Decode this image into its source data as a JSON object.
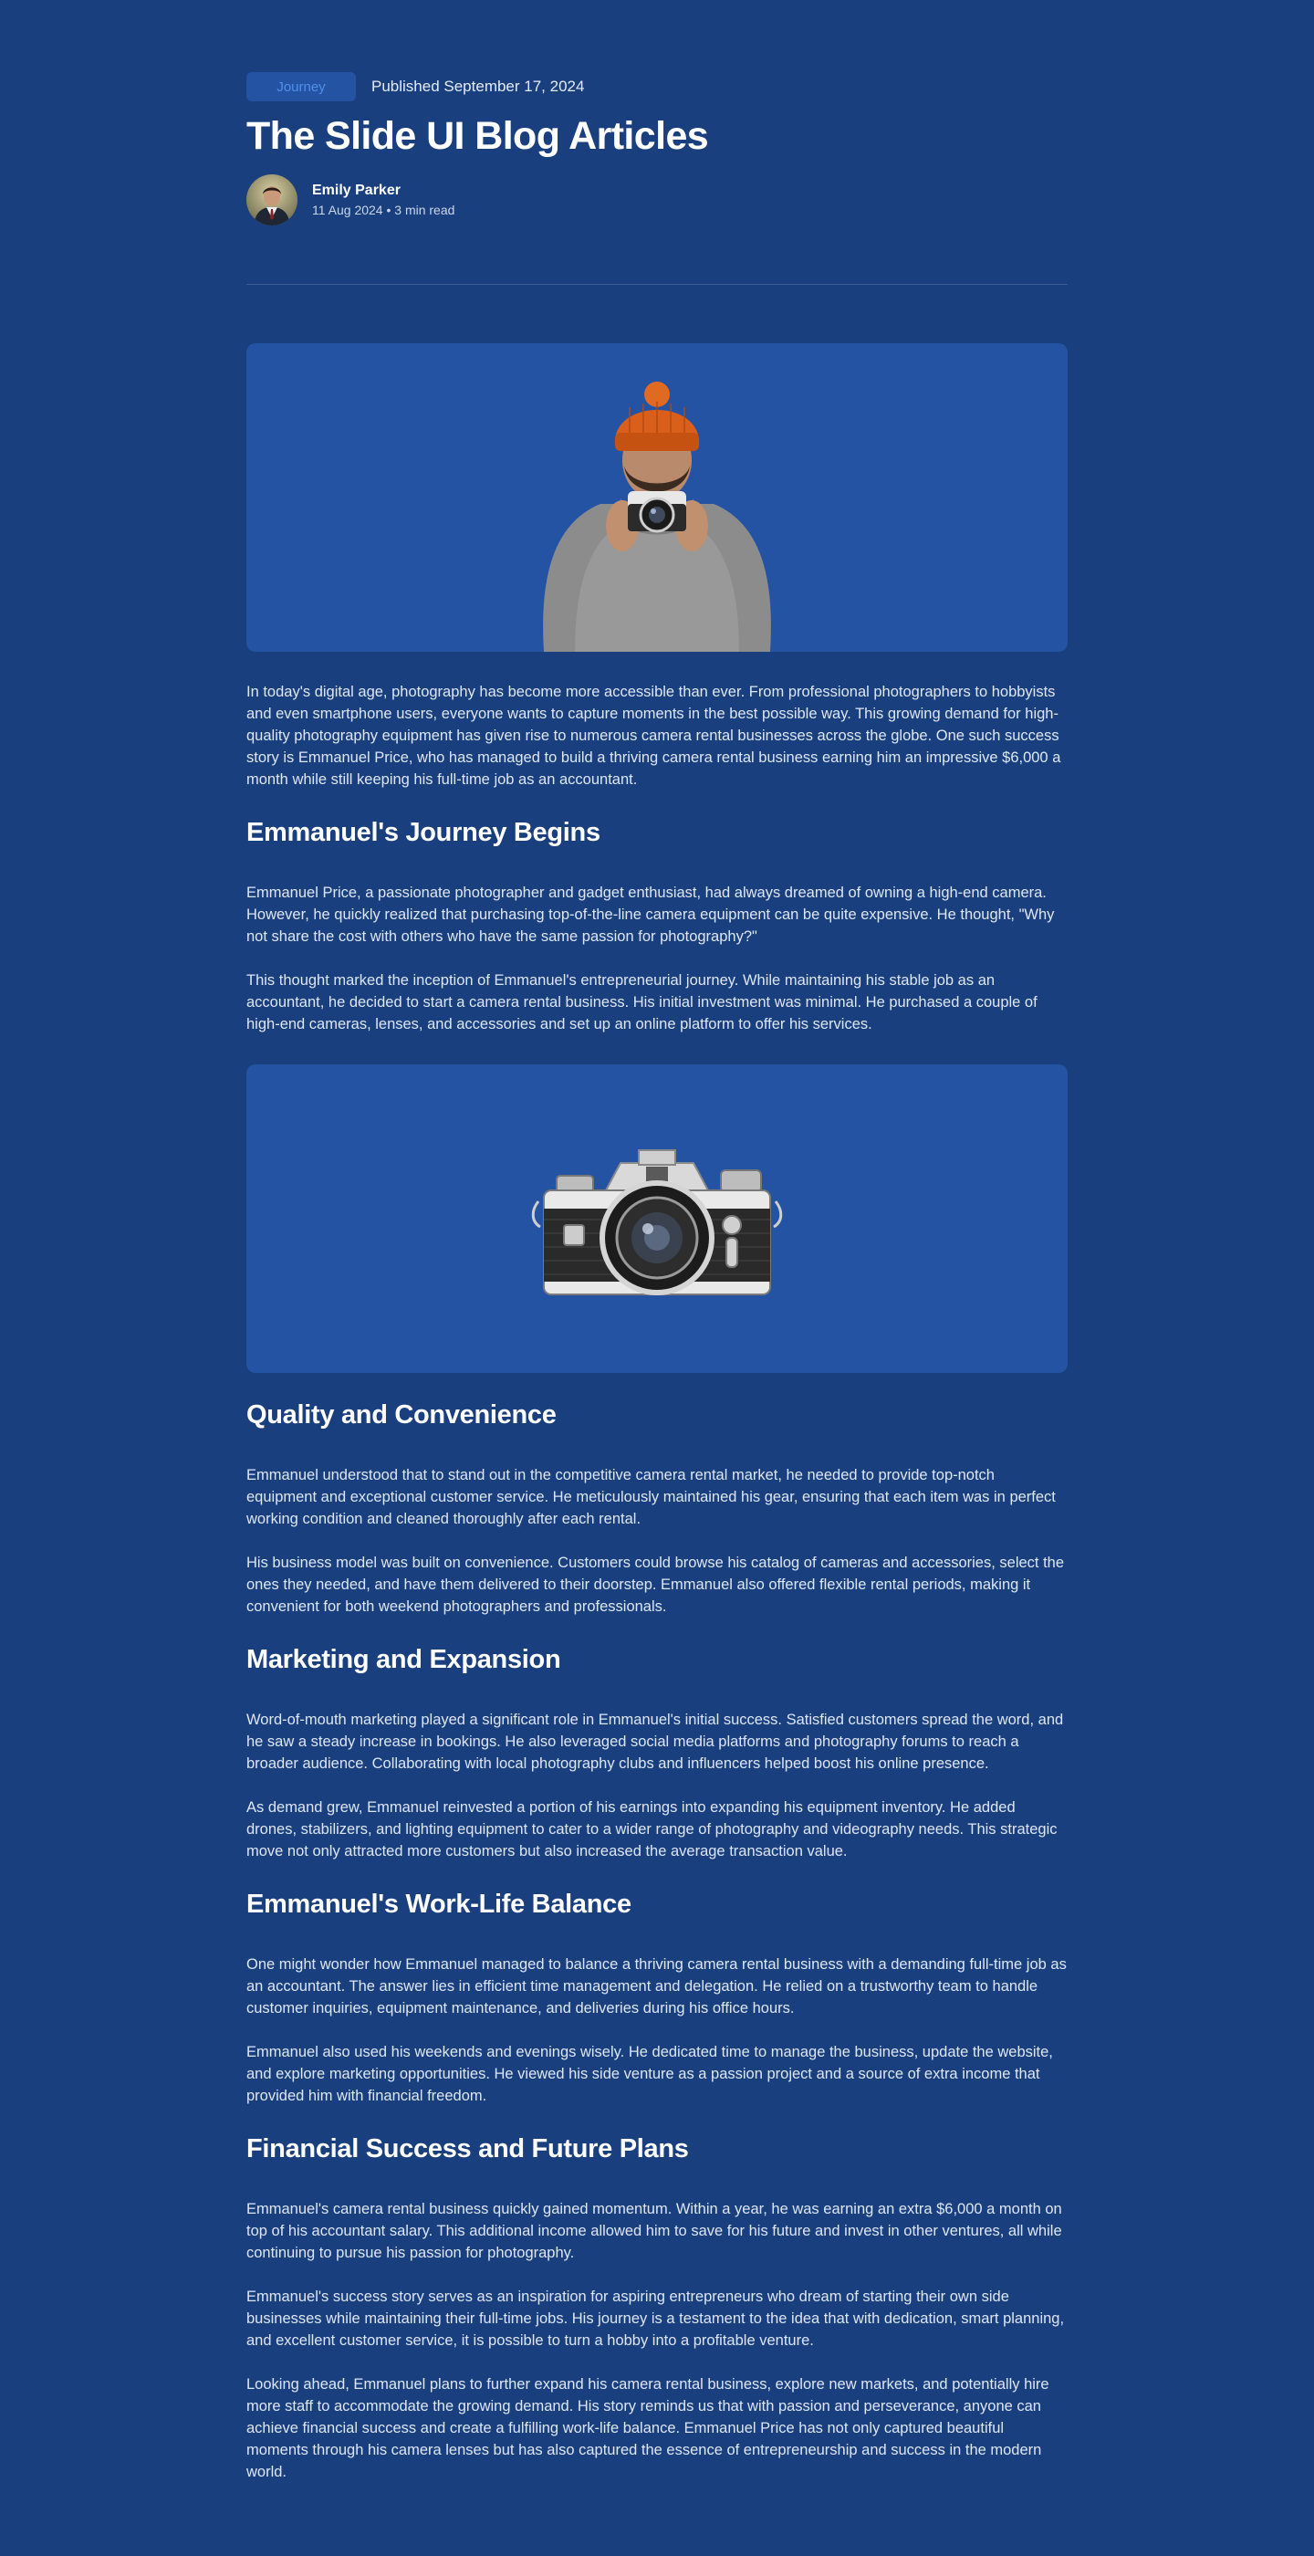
{
  "header": {
    "tag": "Journey",
    "published": "Published September 17, 2024",
    "title": "The Slide UI Blog Articles",
    "author_name": "Emily Parker",
    "author_meta": "11 Aug 2024 • 3 min read"
  },
  "figures": {
    "photographer": "photographer-image",
    "camera": "camera-image"
  },
  "article": {
    "intro": "In today's digital age, photography has become more accessible than ever. From professional photographers to hobbyists and even smartphone users, everyone wants to capture moments in the best possible way. This growing demand for high-quality photography equipment has given rise to numerous camera rental businesses across the globe. One such success story is Emmanuel Price, who has managed to build a thriving camera rental business earning him an impressive $6,000 a month while still keeping his full-time job as an accountant.",
    "s1_heading": "Emmanuel's Journey Begins",
    "s1_p1": "Emmanuel Price, a passionate photographer and gadget enthusiast, had always dreamed of owning a high-end camera. However, he quickly realized that purchasing top-of-the-line camera equipment can be quite expensive. He thought, \"Why not share the cost with others who have the same passion for photography?\"",
    "s1_p2": "This thought marked the inception of Emmanuel's entrepreneurial journey. While maintaining his stable job as an accountant, he decided to start a camera rental business. His initial investment was minimal. He purchased a couple of high-end cameras, lenses, and accessories and set up an online platform to offer his services.",
    "s2_heading": "Quality and Convenience",
    "s2_p1": "Emmanuel understood that to stand out in the competitive camera rental market, he needed to provide top-notch equipment and exceptional customer service. He meticulously maintained his gear, ensuring that each item was in perfect working condition and cleaned thoroughly after each rental.",
    "s2_p2": "His business model was built on convenience. Customers could browse his catalog of cameras and accessories, select the ones they needed, and have them delivered to their doorstep. Emmanuel also offered flexible rental periods, making it convenient for both weekend photographers and professionals.",
    "s3_heading": "Marketing and Expansion",
    "s3_p1": "Word-of-mouth marketing played a significant role in Emmanuel's initial success. Satisfied customers spread the word, and he saw a steady increase in bookings. He also leveraged social media platforms and photography forums to reach a broader audience. Collaborating with local photography clubs and influencers helped boost his online presence.",
    "s3_p2": "As demand grew, Emmanuel reinvested a portion of his earnings into expanding his equipment inventory. He added drones, stabilizers, and lighting equipment to cater to a wider range of photography and videography needs. This strategic move not only attracted more customers but also increased the average transaction value.",
    "s4_heading": "Emmanuel's Work-Life Balance",
    "s4_p1": "One might wonder how Emmanuel managed to balance a thriving camera rental business with a demanding full-time job as an accountant. The answer lies in efficient time management and delegation. He relied on a trustworthy team to handle customer inquiries, equipment maintenance, and deliveries during his office hours.",
    "s4_p2": "Emmanuel also used his weekends and evenings wisely. He dedicated time to manage the business, update the website, and explore marketing opportunities. He viewed his side venture as a passion project and a source of extra income that provided him with financial freedom.",
    "s5_heading": "Financial Success and Future Plans",
    "s5_p1": "Emmanuel's camera rental business quickly gained momentum. Within a year, he was earning an extra $6,000 a month on top of his accountant salary. This additional income allowed him to save for his future and invest in other ventures, all while continuing to pursue his passion for photography.",
    "s5_p2": "Emmanuel's success story serves as an inspiration for aspiring entrepreneurs who dream of starting their own side businesses while maintaining their full-time jobs. His journey is a testament to the idea that with dedication, smart planning, and excellent customer service, it is possible to turn a hobby into a profitable venture.",
    "s5_p3": "Looking ahead, Emmanuel plans to further expand his camera rental business, explore new markets, and potentially hire more staff to accommodate the growing demand. His story reminds us that with passion and perseverance, anyone can achieve financial success and create a fulfilling work-life balance. Emmanuel Price has not only captured beautiful moments through his camera lenses but has also captured the essence of entrepreneurship and success in the modern world."
  }
}
